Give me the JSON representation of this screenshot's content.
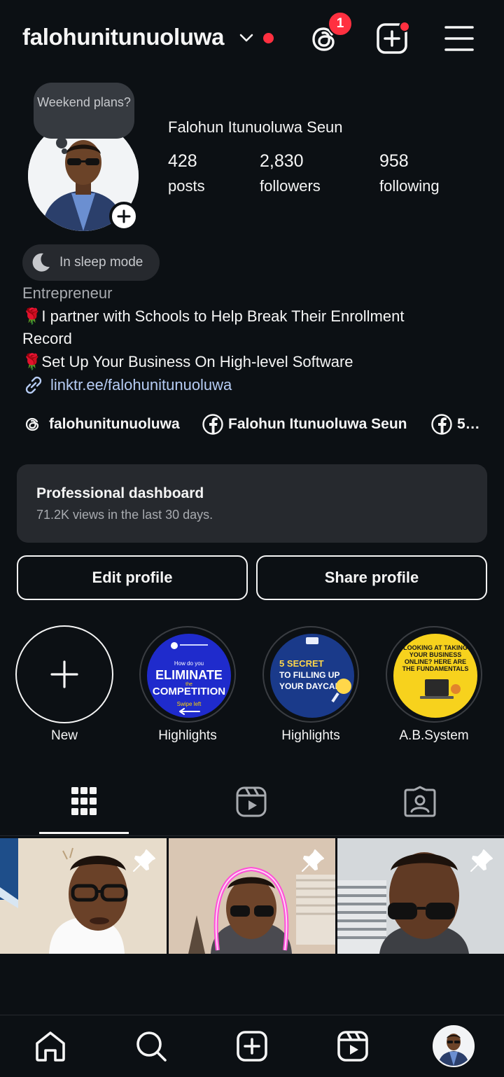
{
  "header": {
    "username": "falohunitunuoluwa",
    "threads_badge_count": "1"
  },
  "profile": {
    "note": "Weekend plans?",
    "full_name": "Falohun Itunuoluwa Seun",
    "stats": {
      "posts": {
        "value": "428",
        "label": "posts"
      },
      "followers": {
        "value": "2,830",
        "label": "followers"
      },
      "following": {
        "value": "958",
        "label": "following"
      }
    },
    "sleep_mode": "In sleep mode",
    "category": "Entrepreneur",
    "bio_line1_emoji": "🌹",
    "bio_line1": "I partner with Schools to Help Break Their Enrollment",
    "bio_line1b": "Record",
    "bio_line2_emoji": "🌹",
    "bio_line2": "Set Up Your Business On High-level Software",
    "link": "linktr.ee/falohunitunuoluwa",
    "social_links": [
      {
        "icon": "threads-icon",
        "label": "falohunitunuoluwa"
      },
      {
        "icon": "facebook-icon",
        "label": "Falohun Itunuoluwa Seun"
      },
      {
        "icon": "facebook-icon",
        "label": "5…"
      }
    ]
  },
  "dashboard": {
    "title": "Professional dashboard",
    "subtitle": "71.2K views in the last 30 days."
  },
  "buttons": {
    "edit": "Edit profile",
    "share": "Share profile"
  },
  "highlights": [
    {
      "label": "New",
      "icon": "plus-icon"
    },
    {
      "label": "Highlights",
      "cover_lines": [
        "How do you",
        "ELIMINATE",
        "the",
        "COMPETITION",
        "Swipe left"
      ]
    },
    {
      "label": "Highlights",
      "cover_lines": [
        "5 SECRET",
        "TO FILLING UP",
        "YOUR DAYCARE"
      ]
    },
    {
      "label": "A.B.System",
      "cover_lines": [
        "LOOKING AT TAKING",
        "YOUR BUSINESS",
        "ONLINE? HERE ARE",
        "THE FUNDAMENTALS"
      ]
    }
  ],
  "tabs": [
    {
      "icon": "grid-icon",
      "active": true
    },
    {
      "icon": "reels-icon",
      "active": false
    },
    {
      "icon": "tagged-icon",
      "active": false
    }
  ],
  "bottom_nav": [
    {
      "icon": "home-icon"
    },
    {
      "icon": "search-icon"
    },
    {
      "icon": "create-icon"
    },
    {
      "icon": "reels-icon"
    },
    {
      "icon": "profile-avatar"
    }
  ],
  "colors": {
    "background": "#0c1014",
    "card": "#26292e",
    "notification_red": "#ff3040",
    "link_blue": "#b6ccf4"
  }
}
